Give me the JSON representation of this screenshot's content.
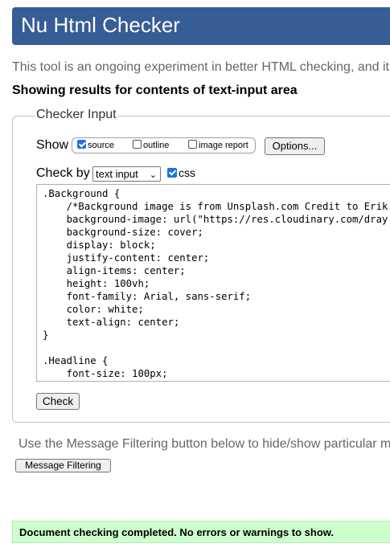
{
  "banner": {
    "title": "Nu Html Checker"
  },
  "intro": {
    "text": "This tool is an ongoing experiment in better HTML checking, and its"
  },
  "results_heading": "Showing results for contents of text-input area",
  "checker_input": {
    "legend": "Checker Input",
    "show_label": "Show",
    "show_options": [
      {
        "label": "source",
        "checked": true
      },
      {
        "label": "outline",
        "checked": false
      },
      {
        "label": "image report",
        "checked": false
      }
    ],
    "options_button": "Options...",
    "check_by_label": "Check by",
    "check_by_value": "text input",
    "css_option": {
      "label": "css",
      "checked": true
    },
    "code_lines": [
      ".Background {",
      "    /*Background image is from Unsplash.com Credit to Erik",
      "    background-image: url(\"https://res.cloudinary.com/dray",
      "    background-size: cover;",
      "    display: block;",
      "    justify-content: center;",
      "    align-items: center;",
      "    height: 100vh;",
      "    font-family: Arial, sans-serif;",
      "    color: white;",
      "    text-align: center;",
      "}",
      "",
      ".Headline {",
      "    font-size: 100px;"
    ],
    "check_button": "Check"
  },
  "filtering": {
    "text": "Use the Message Filtering button below to hide/show particular m",
    "button": "Message Filtering"
  },
  "status": {
    "text": "Document checking completed. No errors or warnings to show.",
    "color": "#ccffcc"
  },
  "colors": {
    "banner": "#365d95",
    "accent": "#1a73e8"
  }
}
